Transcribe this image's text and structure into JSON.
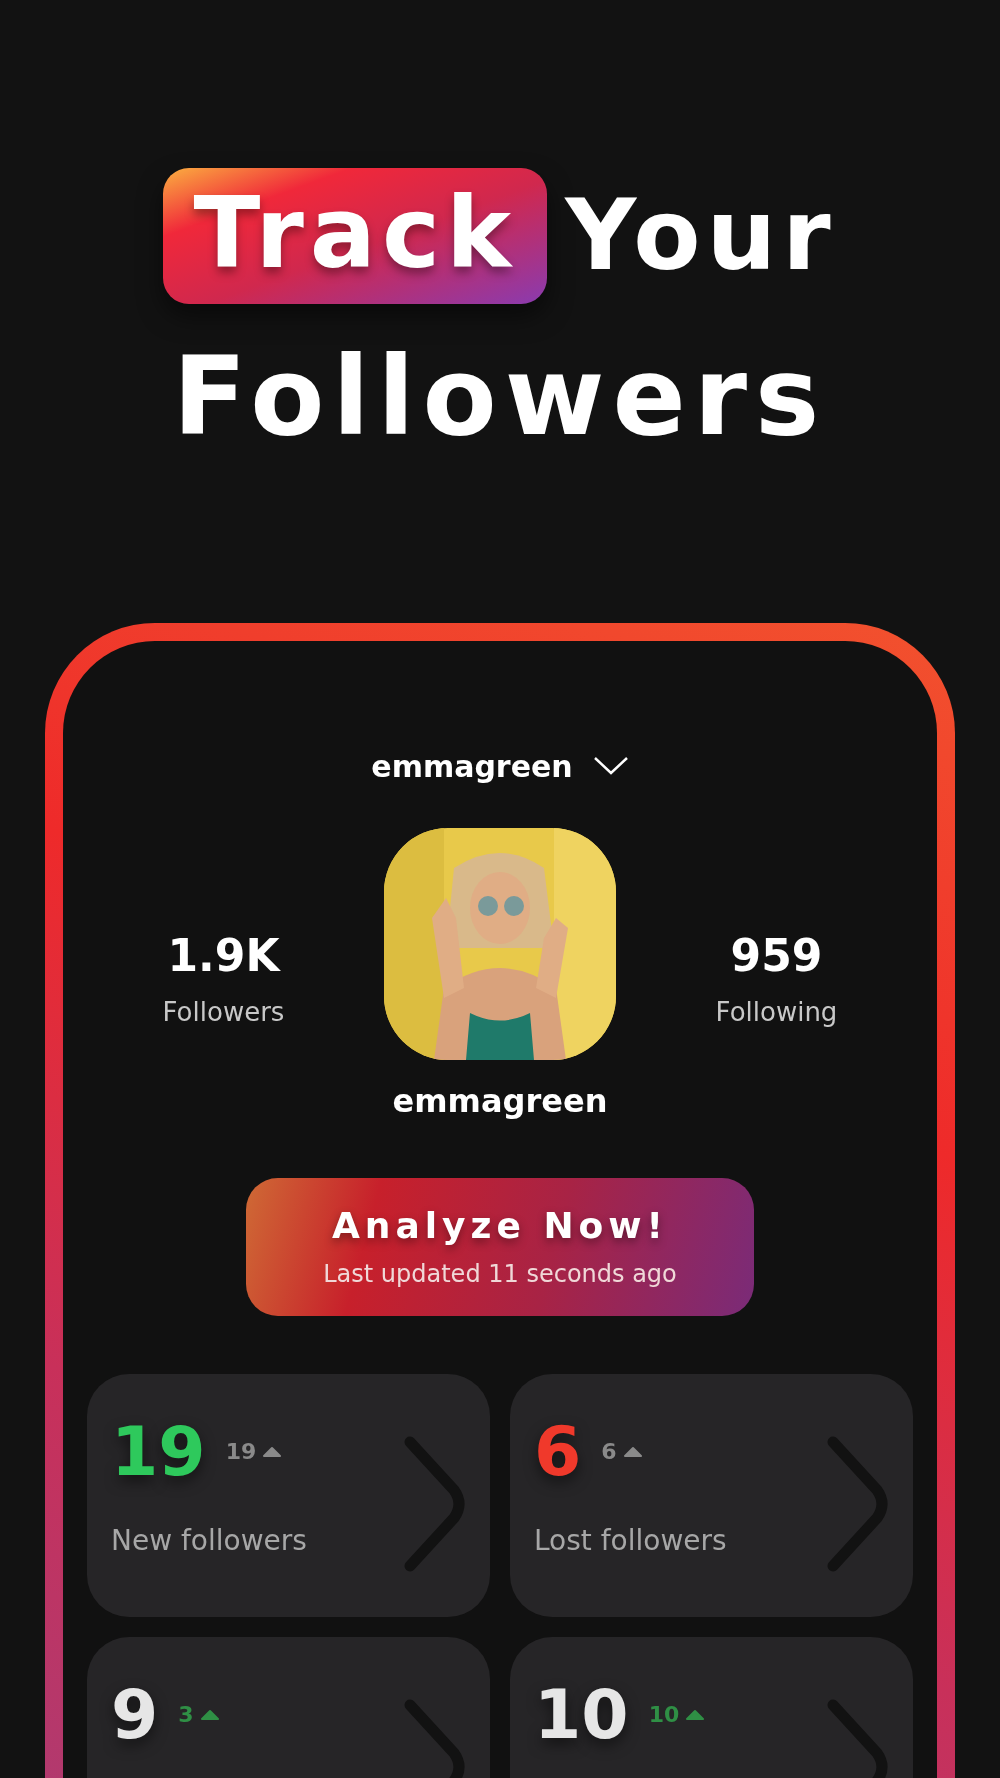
{
  "headline": {
    "highlight": "Track",
    "rest": "Your",
    "line_2": "Followers"
  },
  "profile": {
    "account": "emmagreen",
    "followers_count": "1.9K",
    "followers_label": "Followers",
    "following_count": "959",
    "following_label": "Following",
    "name": "emmagreen"
  },
  "analyze_button": {
    "label": "Analyze Now!",
    "subtitle": "Last updated 11 seconds ago"
  },
  "stat_cards": [
    {
      "value": "19",
      "color": "#2ec95c",
      "delta": "19",
      "kind": "neutral",
      "label": "New followers"
    },
    {
      "value": "6",
      "color": "#f0392b",
      "delta": "6",
      "kind": "neutral",
      "label": "Lost followers"
    },
    {
      "value": "9",
      "color": "#e6e6e6",
      "delta": "3",
      "kind": "up"
    },
    {
      "value": "10",
      "color": "#e6e6e6",
      "delta": "10",
      "kind": "up"
    }
  ]
}
